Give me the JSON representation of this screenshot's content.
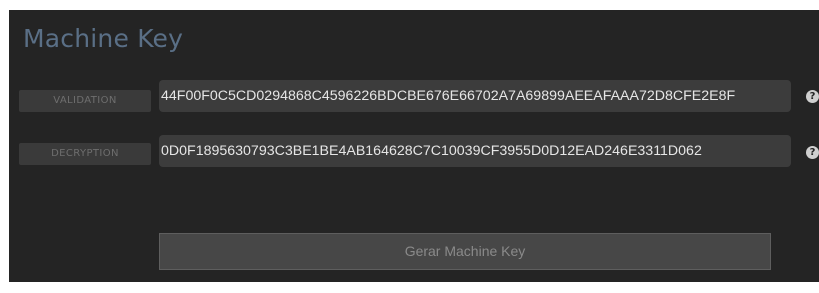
{
  "panel": {
    "title": "Machine Key"
  },
  "fields": [
    {
      "label": "VALIDATION",
      "value": "44F00F0C5CD0294868C4596226BDCBE676E66702A7A69899AEEAFAAA72D8CFE2E8F",
      "help_icon": "question-circle-icon"
    },
    {
      "label": "DECRYPTION",
      "value": "0D0F1895630793C3BE1BE4AB164628C7C10039CF3955D0D12EAD246E3311D062",
      "help_icon": "question-circle-icon"
    }
  ],
  "actions": {
    "generate_label": "Gerar Machine Key"
  },
  "colors": {
    "background": "#242424",
    "title": "#5a6f86",
    "field": "#3c3c3c",
    "button": "#474747"
  }
}
